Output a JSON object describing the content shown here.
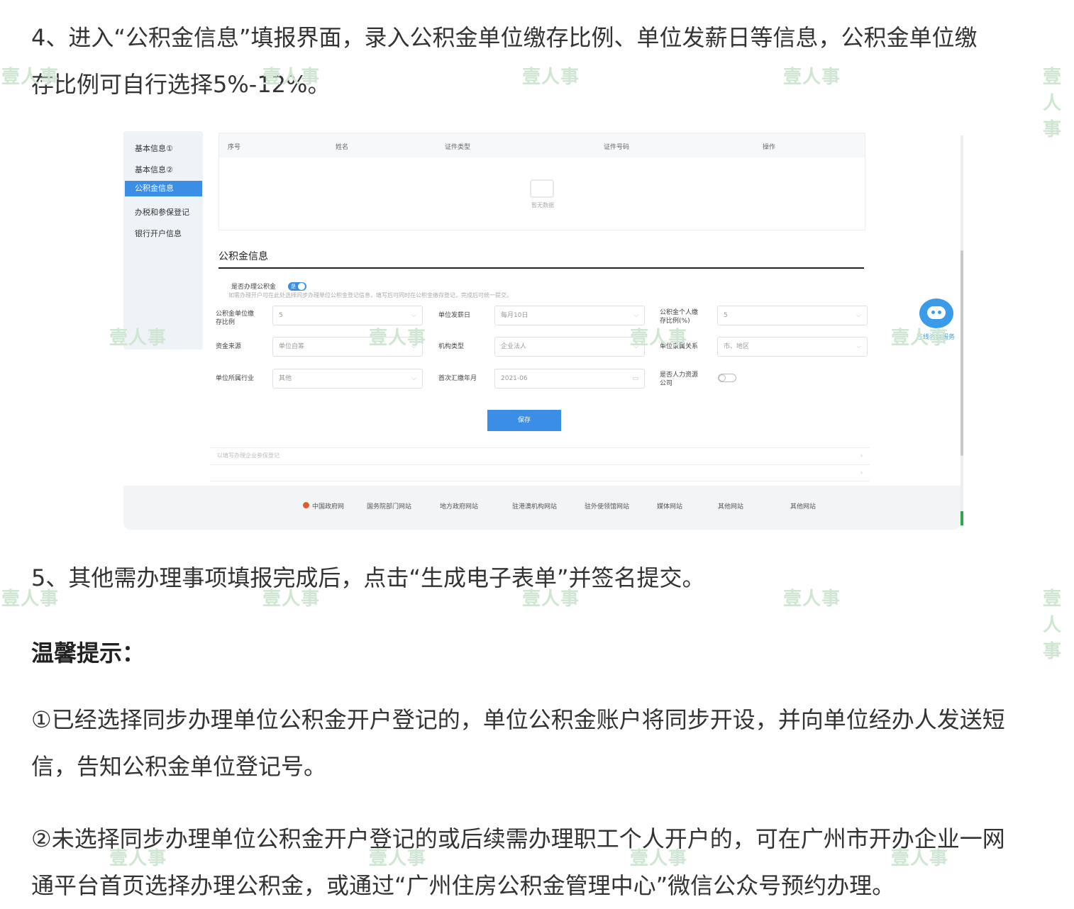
{
  "paragraphs": {
    "step4_line1": "4、进入“公积金信息”填报界面，录入公积金单位缴存比例、单位发薪日等信息，公积金单位缴",
    "step4_line2": "存比例可自行选择5%-12%。",
    "step5": "5、其他需办理事项填报完成后，点击“生成电子表单”并签名提交。",
    "tips_heading": "温馨提示：",
    "tip1_line1": "①已经选择同步办理单位公积金开户登记的，单位公积金账户将同步开设，并向单位经办人发送短",
    "tip1_line2": "信，告知公积金单位登记号。",
    "tip2_line1": "②未选择同步办理单位公积金开户登记的或后续需办理职工个人开户的，可在广州市开办企业一网",
    "tip2_line2": "通平台首页选择办理公积金，或通过“广州住房公积金管理中心”微信公众号预约办理。"
  },
  "watermark": "壹人事",
  "screenshot": {
    "sidebar": [
      "基本信息①",
      "基本信息②",
      "公积金信息",
      "办税和参保登记",
      "银行开户信息"
    ],
    "sidebar_active_index": 2,
    "table_headers": [
      "序号",
      "姓名",
      "证件类型",
      "证件号码",
      "操作"
    ],
    "table_empty_text": "暂无数据",
    "section_title": "公积金信息",
    "switch_label": "是否办理公积金",
    "switch_on_text": "是",
    "hint_text": "如需办理开户可在此处选择同步办理单位公积金登记信息，填写后可同时在公积金缴存登记，完成后可统一提交。",
    "fields": {
      "ratio_label": "公积金单位缴存比例",
      "ratio_value": "5",
      "payday_label": "单位发薪日",
      "payday_value": "每月10日",
      "personal_ratio_label": "公积金个人缴存比例(%)",
      "personal_ratio_value": "5",
      "fund_source_label": "资金来源",
      "fund_source_value": "单位自筹",
      "org_type_label": "机构类型",
      "org_type_value": "企业法人",
      "affiliation_label": "单位隶属关系",
      "affiliation_value": "市、地区",
      "industry_label": "单位所属行业",
      "industry_value": "其他",
      "first_month_label": "首次汇缴年月",
      "first_month_value": "2021-06",
      "entrust_label": "是否人力资源公司",
      "entrust_on": false
    },
    "save_button": "保存",
    "fold_text": "以填写办理企业参保登记",
    "footer_links": [
      "中国政府网",
      "国务院部门网站",
      "地方政府网站",
      "驻港澳机构网站",
      "驻外使领馆网站",
      "媒体网站",
      "其他网站",
      "其他网站"
    ],
    "robot_label": "在线咨询服务",
    "accent_color": "#3a8ee6"
  }
}
